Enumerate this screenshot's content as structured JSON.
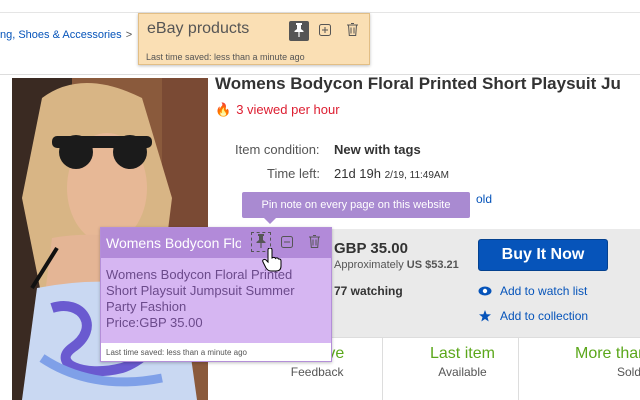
{
  "breadcrumb": {
    "text": "ng, Shoes & Accessories",
    "separator": ">"
  },
  "listing": {
    "title": "Womens Bodycon Floral Printed Short Playsuit Ju",
    "viewed": "3 viewed per hour",
    "item_condition_label": "Item condition:",
    "item_condition_value": "New with tags",
    "time_left_label": "Time left:",
    "time_left_value": "21d 19h",
    "time_left_date": "2/19, 11:49AM",
    "sold_fragment": "old",
    "price": "GBP 35.00",
    "approx_label": "Approximately",
    "approx_value": "US $53.21",
    "watching": "77 watching",
    "buy_label": "Buy It Now",
    "watch_link": "Add to watch list",
    "collection_link": "Add to collection"
  },
  "stats": [
    {
      "big": "positive",
      "small": "Feedback"
    },
    {
      "big": "Last item",
      "small": "Available"
    },
    {
      "big": "More than",
      "small": "Sold"
    }
  ],
  "note_orange": {
    "title": "eBay products",
    "saved": "Last time saved: less than a minute ago",
    "color": "#fadfb4"
  },
  "note_purple": {
    "title": "Womens Bodycon Floral Printed Short Playsuit Jumpsuit Summer Party Fashion",
    "body_lines": [
      "Womens Bodycon Floral Printed",
      "Short Playsuit Jumpsuit Summer",
      "Party Fashion",
      "Price:GBP 35.00"
    ],
    "saved": "Last time saved: less than a minute ago",
    "color": "#d6b6f2"
  },
  "tooltip": "Pin note on every page on this website",
  "colors": {
    "ebay_blue": "#0654ba",
    "green": "#5ba71b",
    "red": "#dd1e31"
  },
  "icons": [
    "flame-icon",
    "pin-icon",
    "add-note-icon",
    "trash-icon",
    "minimize-icon",
    "eye-icon",
    "star-icon",
    "hand-cursor-icon"
  ]
}
